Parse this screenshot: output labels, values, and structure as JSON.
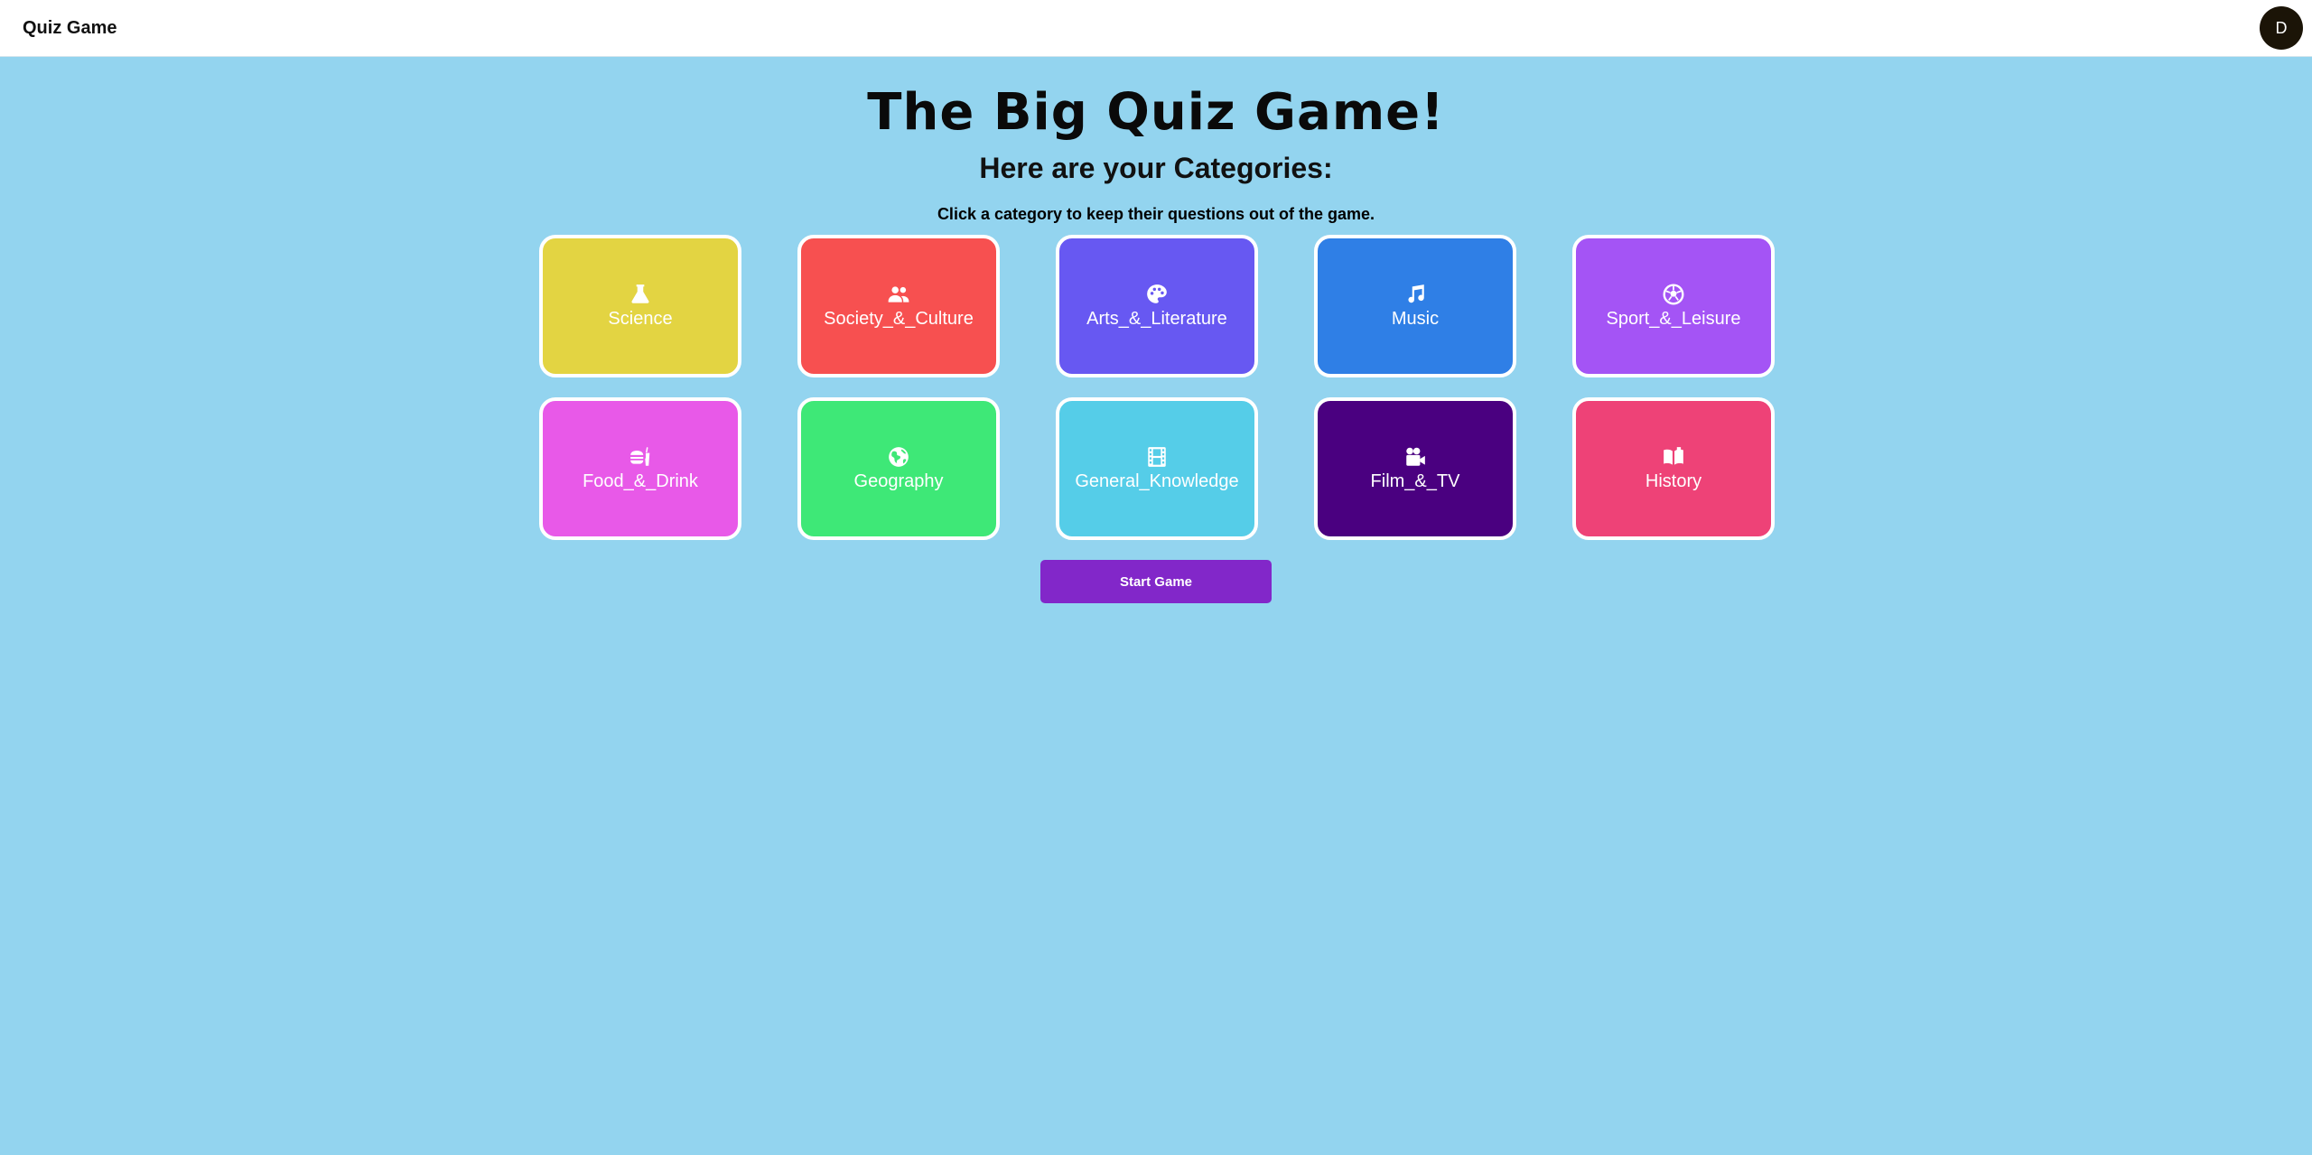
{
  "header": {
    "title": "Quiz Game",
    "avatar_initial": "D"
  },
  "main": {
    "title": "The Big Quiz Game!",
    "subtitle": "Here are your Categories:",
    "instructions": "Click a category to keep their questions out of the game.",
    "start_button_label": "Start Game"
  },
  "categories": [
    {
      "label": "Science",
      "icon": "flask-icon",
      "color": "#e3d442"
    },
    {
      "label": "Society_&_Culture",
      "icon": "users-icon",
      "color": "#f75050"
    },
    {
      "label": "Arts_&_Literature",
      "icon": "palette-icon",
      "color": "#6758f2"
    },
    {
      "label": "Music",
      "icon": "music-icon",
      "color": "#2f7fe6"
    },
    {
      "label": "Sport_&_Leisure",
      "icon": "soccer-ball-icon",
      "color": "#a454f5"
    },
    {
      "label": "Food_&_Drink",
      "icon": "burger-drink-icon",
      "color": "#e859e8"
    },
    {
      "label": "Geography",
      "icon": "globe-icon",
      "color": "#3ee877"
    },
    {
      "label": "General_Knowledge",
      "icon": "film-strip-icon",
      "color": "#55cde8"
    },
    {
      "label": "Film_&_TV",
      "icon": "video-camera-icon",
      "color": "#4a0080"
    },
    {
      "label": "History",
      "icon": "book-open-icon",
      "color": "#ee4277"
    }
  ],
  "colors": {
    "background": "#93d4ef",
    "topbar": "#ffffff",
    "avatar": "#1b1407",
    "start_button": "#8227c9",
    "card_border": "#ffffff"
  }
}
